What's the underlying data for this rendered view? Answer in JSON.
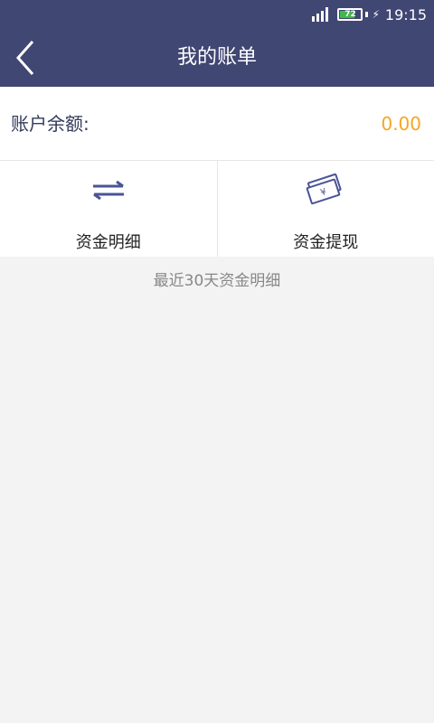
{
  "status_bar": {
    "battery_level": "72",
    "time": "19:15",
    "icons": [
      "signal-icon",
      "battery-icon",
      "charging-icon"
    ]
  },
  "header": {
    "title": "我的账单",
    "back_icon": "chevron-left-icon"
  },
  "balance": {
    "label": "账户余额:",
    "value": "0.00"
  },
  "actions": [
    {
      "label": "资金明细",
      "icon": "transfer-arrows-icon"
    },
    {
      "label": "资金提现",
      "icon": "cash-withdraw-icon"
    }
  ],
  "recent_label": "最近30天资金明细",
  "colors": {
    "header_bg": "#414773",
    "accent_icon": "#4a5496",
    "balance_value": "#f5a623",
    "page_bg": "#f3f3f3"
  }
}
